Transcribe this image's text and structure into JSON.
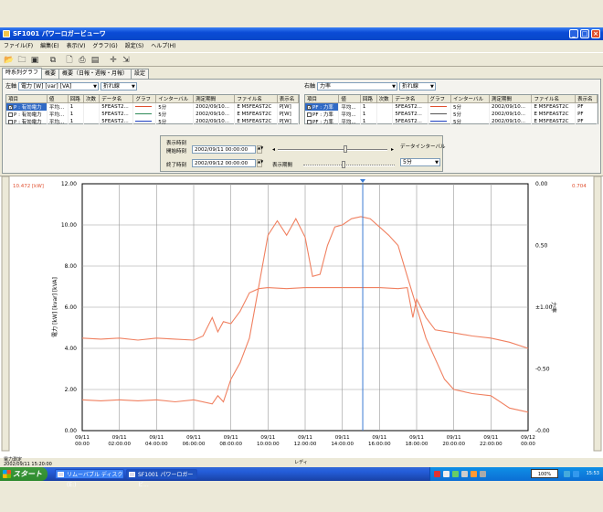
{
  "window": {
    "title": "SF1001 パワーロガービューワ"
  },
  "menu": [
    "ファイル(F)",
    "編集(E)",
    "表示(V)",
    "グラフ(G)",
    "設定(S)",
    "ヘルプ(H)"
  ],
  "tabs": [
    "時系列グラフ",
    "概要",
    "概要（日報・週報・月報）",
    "設定"
  ],
  "left_panel": {
    "axis_label": "左軸",
    "axis_value": "電力 [W] [var] [VA]",
    "graph_type": "折れ線",
    "headers": [
      "項目",
      "値",
      "回路",
      "次数",
      "データ名",
      "グラフ",
      "インターバル",
      "測定期間",
      "ファイル名",
      "表示名"
    ],
    "rows": [
      {
        "item": "P : 有効電力",
        "value": "平均...",
        "circuit": "1",
        "data": "5FEAST2...",
        "interval": "5分",
        "period": "2002/09/10...",
        "file": "E M5FEAST2C",
        "disp": "P[W]",
        "checked": "✓",
        "color": "#e05030"
      },
      {
        "item": "P : 有効電力",
        "value": "平均...",
        "circuit": "1",
        "data": "5FEAST2...",
        "interval": "5分",
        "period": "2002/09/10...",
        "file": "E M5FEAST2C",
        "disp": "P[W]",
        "checked": "",
        "color": "#2e8b57"
      },
      {
        "item": "P : 有効電力",
        "value": "平均...",
        "circuit": "1",
        "data": "5FEAST2...",
        "interval": "5分",
        "period": "2002/09/10...",
        "file": "E M5FEAST2C",
        "disp": "P[W]",
        "checked": "",
        "color": "#1e40c0"
      }
    ]
  },
  "right_panel": {
    "axis_label": "右軸",
    "axis_value": "力率",
    "graph_type": "折れ線",
    "headers": [
      "項目",
      "値",
      "回路",
      "次数",
      "データ名",
      "グラフ",
      "インターバル",
      "測定期間",
      "ファイル名",
      "表示名"
    ],
    "rows": [
      {
        "item": "PF : 力率",
        "value": "平均...",
        "circuit": "1",
        "data": "5FEAST2...",
        "interval": "5分",
        "period": "2002/09/10...",
        "file": "E M5FEAST2C",
        "disp": "PF",
        "checked": "✓",
        "color": "#e05030"
      },
      {
        "item": "PF : 力率",
        "value": "平均...",
        "circuit": "1",
        "data": "5FEAST2...",
        "interval": "5分",
        "period": "2002/09/10...",
        "file": "E M5FEAST2C",
        "disp": "PF",
        "checked": "",
        "color": "#555555"
      },
      {
        "item": "PF : 力率",
        "value": "平均...",
        "circuit": "1",
        "data": "5FEAST2...",
        "interval": "5分",
        "period": "2002/09/10...",
        "file": "E M5FEAST2C",
        "disp": "PF",
        "checked": "",
        "color": "#1e40c0"
      }
    ]
  },
  "controls": {
    "display_time_label": "表示時刻",
    "start_label": "開始時刻",
    "end_label": "終了時刻",
    "start_value": "2002/09/11 00:00:00",
    "end_value": "2002/09/12 00:00:00",
    "data_interval_label": "データインターバル",
    "display_period_label": "表示期間",
    "interval_value": "5分"
  },
  "chart_header": {
    "left_value": "10.472 [kW]",
    "right_value": "0.704"
  },
  "chart_data": {
    "type": "line",
    "ylabel": "電力 [kW] [kvar] [kVA]",
    "y2label": "力率",
    "ylim": [
      0,
      12
    ],
    "yticks": [
      "0.00",
      "2.00",
      "4.00",
      "6.00",
      "8.00",
      "10.00",
      "12.00"
    ],
    "y2ticks": [
      "-0.00",
      "-0.50",
      "±1.00",
      "0.50",
      "0.00"
    ],
    "x_hours": [
      0,
      2,
      4,
      6,
      8,
      10,
      12,
      14,
      16,
      18,
      20,
      22,
      24
    ],
    "xticks": [
      {
        "date": "09/11",
        "time": "00:00"
      },
      {
        "date": "09/11",
        "time": "02:00:00"
      },
      {
        "date": "09/11",
        "time": "04:00:00"
      },
      {
        "date": "09/11",
        "time": "06:00:00"
      },
      {
        "date": "09/11",
        "time": "08:00:00"
      },
      {
        "date": "09/11",
        "time": "10:00:00"
      },
      {
        "date": "09/11",
        "time": "12:00:00"
      },
      {
        "date": "09/11",
        "time": "14:00:00"
      },
      {
        "date": "09/11",
        "time": "16:00:00"
      },
      {
        "date": "09/11",
        "time": "18:00:00"
      },
      {
        "date": "09/11",
        "time": "20:00:00"
      },
      {
        "date": "09/11",
        "time": "22:00:00"
      },
      {
        "date": "09/12",
        "time": "00:00"
      }
    ],
    "cursor_hour": 15.1,
    "series": [
      {
        "color": "#f08060",
        "points": [
          [
            0,
            1.5
          ],
          [
            1,
            1.45
          ],
          [
            2,
            1.5
          ],
          [
            3,
            1.45
          ],
          [
            4,
            1.5
          ],
          [
            5,
            1.4
          ],
          [
            6,
            1.5
          ],
          [
            7,
            1.3
          ],
          [
            7.3,
            1.7
          ],
          [
            7.6,
            1.4
          ],
          [
            8,
            2.5
          ],
          [
            8.5,
            3.3
          ],
          [
            9,
            4.5
          ],
          [
            9.5,
            7.0
          ],
          [
            10,
            9.5
          ],
          [
            10.5,
            10.2
          ],
          [
            11,
            9.5
          ],
          [
            11.5,
            10.3
          ],
          [
            12,
            9.4
          ],
          [
            12.4,
            7.5
          ],
          [
            12.8,
            7.6
          ],
          [
            13.2,
            9.0
          ],
          [
            13.6,
            9.9
          ],
          [
            14,
            10.0
          ],
          [
            14.5,
            10.3
          ],
          [
            15,
            10.4
          ],
          [
            15.5,
            10.3
          ],
          [
            16,
            9.9
          ],
          [
            16.5,
            9.5
          ],
          [
            17,
            9.0
          ],
          [
            17.5,
            7.5
          ],
          [
            18,
            6.0
          ],
          [
            18.5,
            4.5
          ],
          [
            19,
            3.5
          ],
          [
            19.5,
            2.5
          ],
          [
            20,
            2.0
          ],
          [
            21,
            1.8
          ],
          [
            22,
            1.7
          ],
          [
            23,
            1.1
          ],
          [
            24,
            0.9
          ]
        ]
      },
      {
        "color": "#f08060",
        "points": [
          [
            0,
            4.5
          ],
          [
            1,
            4.45
          ],
          [
            2,
            4.5
          ],
          [
            3,
            4.4
          ],
          [
            4,
            4.5
          ],
          [
            5,
            4.45
          ],
          [
            6,
            4.4
          ],
          [
            6.5,
            4.6
          ],
          [
            7,
            5.5
          ],
          [
            7.3,
            4.8
          ],
          [
            7.6,
            5.3
          ],
          [
            8,
            5.2
          ],
          [
            8.5,
            5.8
          ],
          [
            9,
            6.7
          ],
          [
            9.5,
            6.9
          ],
          [
            10,
            6.95
          ],
          [
            11,
            6.9
          ],
          [
            12,
            6.95
          ],
          [
            13,
            6.95
          ],
          [
            14,
            6.95
          ],
          [
            15,
            6.95
          ],
          [
            16,
            6.95
          ],
          [
            17,
            6.9
          ],
          [
            17.5,
            6.95
          ],
          [
            17.8,
            5.5
          ],
          [
            18,
            6.4
          ],
          [
            18.5,
            5.5
          ],
          [
            19,
            4.9
          ],
          [
            20,
            4.75
          ],
          [
            21,
            4.6
          ],
          [
            22,
            4.5
          ],
          [
            23,
            4.3
          ],
          [
            24,
            4.0
          ]
        ]
      }
    ]
  },
  "status": {
    "left": "電力測定",
    "date": "2002/09/11 15:20:00"
  },
  "taskbar": {
    "start": "スタート",
    "tasks": [
      "リムーバブル ディスク (E:)",
      "SF1001 パワーロガービ..."
    ],
    "center": "レディ",
    "battery": "100%",
    "clock": "15:53"
  }
}
